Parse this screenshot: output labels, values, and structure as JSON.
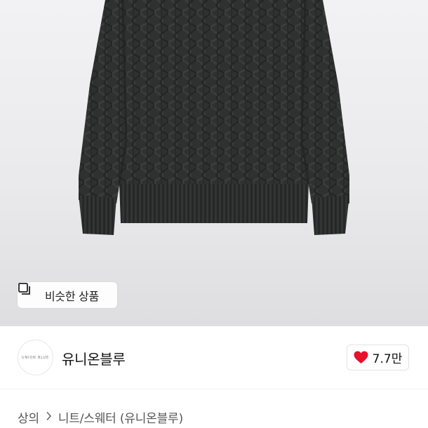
{
  "product_image": {
    "subject": "sweater-photo"
  },
  "similar_button": {
    "label": "비슷한 상품",
    "icon": "similar-items-icon"
  },
  "seller": {
    "avatar_text": "UNION BLUE",
    "name": "유니온블루"
  },
  "like": {
    "count": "7.7만",
    "icon": "heart-icon",
    "color": "#e8112d"
  },
  "breadcrumb": {
    "items": [
      "상의",
      "니트/스웨터 (유니온블루)"
    ],
    "separator_icon": "chevron-right-icon"
  },
  "colors": {
    "sweater": "#2e302f",
    "background": "#ebebed"
  }
}
